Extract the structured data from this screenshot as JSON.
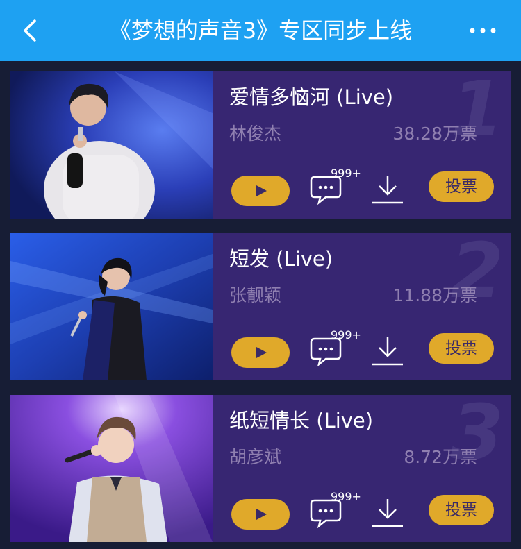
{
  "header": {
    "title": "《梦想的声音3》专区同步上线"
  },
  "colors": {
    "header_bg": "#1ea1f2",
    "card_bg": "#372672",
    "accent": "#e0a92a",
    "muted_text": "#8f7fb0"
  },
  "icons": [
    "back-arrow-icon",
    "more-icon",
    "play-icon",
    "comment-icon",
    "download-icon"
  ],
  "songs": [
    {
      "rank": "1",
      "title": "爱情多恼河 (Live)",
      "singer": "林俊杰",
      "votes": "38.28万票",
      "comment_count": "999+",
      "vote_label": "投票"
    },
    {
      "rank": "2",
      "title": "短发 (Live)",
      "singer": "张靓颖",
      "votes": "11.88万票",
      "comment_count": "999+",
      "vote_label": "投票"
    },
    {
      "rank": "3",
      "title": "纸短情长 (Live)",
      "singer": "胡彦斌",
      "votes": "8.72万票",
      "comment_count": "999+",
      "vote_label": "投票"
    }
  ]
}
